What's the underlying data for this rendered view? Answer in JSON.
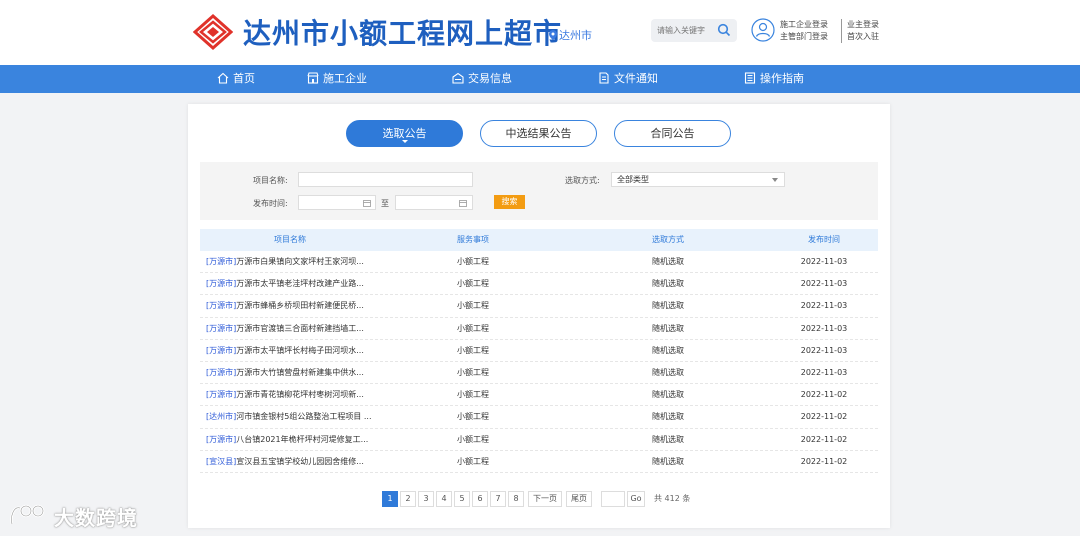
{
  "header": {
    "site_title": "达州市小额工程网上超市",
    "city": "达州市",
    "search_placeholder": "请输入关键字",
    "login": {
      "contractor_login": "施工企业登录",
      "dept_login": "主管部门登录",
      "owner_login": "业主登录",
      "first_entry": "首次入驻"
    }
  },
  "nav": {
    "items": [
      {
        "label": "首页",
        "icon": "home-icon"
      },
      {
        "label": "施工企业",
        "icon": "store-icon"
      },
      {
        "label": "交易信息",
        "icon": "shop-icon"
      },
      {
        "label": "文件通知",
        "icon": "document-icon"
      },
      {
        "label": "操作指南",
        "icon": "guide-icon"
      }
    ]
  },
  "tabs": [
    "选取公告",
    "中选结果公告",
    "合同公告"
  ],
  "filter": {
    "project_name_label": "项目名称:",
    "publish_time_label": "发布时间:",
    "to_label": "至",
    "method_label": "选取方式:",
    "method_value": "全部类型",
    "search_button": "搜索"
  },
  "table": {
    "headers": [
      "项目名称",
      "服务事项",
      "选取方式",
      "发布时间"
    ],
    "rows": [
      {
        "tag": "[万源市]",
        "name": "万源市白果镇向文家坪村王家河坝...",
        "service": "小额工程",
        "method": "随机选取",
        "date": "2022-11-03"
      },
      {
        "tag": "[万源市]",
        "name": "万源市太平镇老洼坪村改建产业路...",
        "service": "小额工程",
        "method": "随机选取",
        "date": "2022-11-03"
      },
      {
        "tag": "[万源市]",
        "name": "万源市蜂桶乡桥坝田村新建便民桥...",
        "service": "小额工程",
        "method": "随机选取",
        "date": "2022-11-03"
      },
      {
        "tag": "[万源市]",
        "name": "万源市官渡镇三合面村新建挡墙工...",
        "service": "小额工程",
        "method": "随机选取",
        "date": "2022-11-03"
      },
      {
        "tag": "[万源市]",
        "name": "万源市太平镇坪长村梅子田河坝水...",
        "service": "小额工程",
        "method": "随机选取",
        "date": "2022-11-03"
      },
      {
        "tag": "[万源市]",
        "name": "万源市大竹镇营盘村新建集中供水...",
        "service": "小额工程",
        "method": "随机选取",
        "date": "2022-11-03"
      },
      {
        "tag": "[万源市]",
        "name": "万源市青花镇柳花坪村枣树河坝新...",
        "service": "小额工程",
        "method": "随机选取",
        "date": "2022-11-02"
      },
      {
        "tag": "[达州市]",
        "name": "河市镇金银村5组公路整治工程项目 ...",
        "service": "小额工程",
        "method": "随机选取",
        "date": "2022-11-02"
      },
      {
        "tag": "[万源市]",
        "name": "八台镇2021年桅杆坪村河堤修复工...",
        "service": "小额工程",
        "method": "随机选取",
        "date": "2022-11-02"
      },
      {
        "tag": "[宣汉县]",
        "name": "宣汉县五宝镇学校幼儿园园舍维修...",
        "service": "小额工程",
        "method": "随机选取",
        "date": "2022-11-02"
      }
    ]
  },
  "pager": {
    "pages": [
      "1",
      "2",
      "3",
      "4",
      "5",
      "6",
      "7",
      "8"
    ],
    "next": "下一页",
    "last": "尾页",
    "go": "Go",
    "total": "共 412 条"
  },
  "watermark": "大数跨境",
  "colors": {
    "primary": "#3a84de",
    "title": "#1e5fbf",
    "logo": "#e0322a",
    "button": "#f39c12"
  }
}
